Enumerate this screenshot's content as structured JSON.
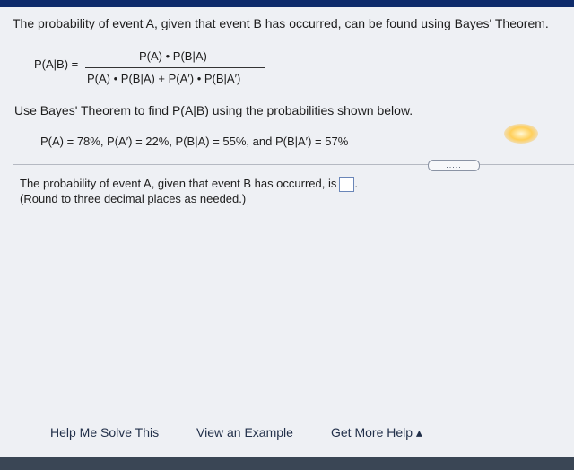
{
  "problem": {
    "intro": "The probability of event A, given that event B has occurred, can be found using Bayes' Theorem.",
    "formula_lhs": "P(A|B) =",
    "formula_numerator": "P(A) • P(B|A)",
    "formula_denominator": "P(A) • P(B|A) + P(A′) • P(B|A′)",
    "instruction": "Use Bayes' Theorem to find P(A|B) using the probabilities shown below.",
    "givens": "P(A) = 78%, P(A′) = 22%, P(B|A) = 55%, and P(B|A′) = 57%"
  },
  "expand_button": {
    "label": "....."
  },
  "answer": {
    "prompt": "The probability of event A, given that event B has occurred, is",
    "value": "",
    "note": "(Round to three decimal places as needed.)"
  },
  "footer": {
    "help_me_solve": "Help Me Solve This",
    "view_example": "View an Example",
    "get_more_help": "Get More Help ▴"
  }
}
